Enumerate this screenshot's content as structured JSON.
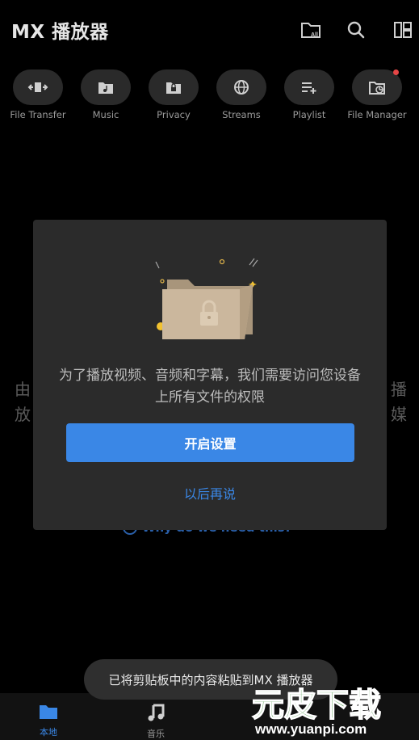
{
  "app": {
    "title": "MX 播放器"
  },
  "toolbar": {
    "folder_all_text": "All"
  },
  "shortcuts": [
    {
      "label": "File Transfer",
      "icon": "file-transfer-icon"
    },
    {
      "label": "Music",
      "icon": "music-icon"
    },
    {
      "label": "Privacy",
      "icon": "lock-icon"
    },
    {
      "label": "Streams",
      "icon": "globe-icon"
    },
    {
      "label": "Playlist",
      "icon": "playlist-icon"
    },
    {
      "label": "File Manager",
      "icon": "file-manager-icon",
      "badge": true
    }
  ],
  "background": {
    "left_line1": "由",
    "left_line2": "放",
    "right_line1": "播",
    "right_line2": "媒",
    "link_text": "Why do we need this?"
  },
  "dialog": {
    "message": "为了播放视频、音频和字幕，我们需要访问您设备上所有文件的权限",
    "primary_button": "开启设置",
    "secondary_button": "以后再说"
  },
  "bottom_nav": [
    {
      "label": "本地",
      "icon": "folder-icon",
      "active": true
    },
    {
      "label": "音乐",
      "icon": "music-note-icon",
      "active": false
    }
  ],
  "toast": {
    "message": "已将剪贴板中的内容粘贴到MX 播放器"
  },
  "watermark": {
    "brand": "元皮下载",
    "url": "www.yuanpi.com"
  },
  "colors": {
    "accent": "#3a87e6",
    "dialog_bg": "#2b2b2b",
    "badge": "#e54646",
    "folder": "#c8b49a",
    "star": "#f2c230"
  }
}
